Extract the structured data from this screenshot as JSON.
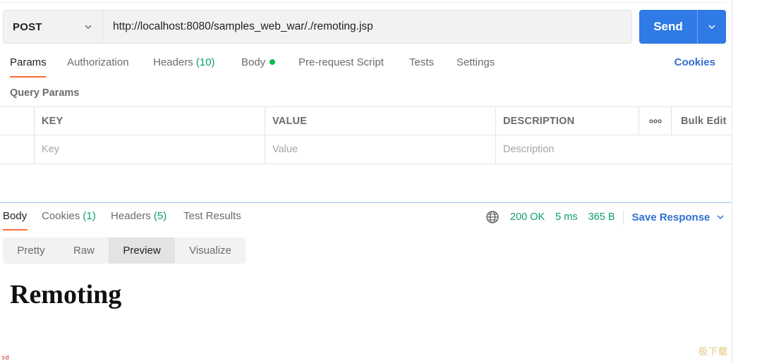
{
  "request": {
    "method": "POST",
    "url": "http://localhost:8080/samples_web_war/./remoting.jsp",
    "send_label": "Send"
  },
  "request_tabs": {
    "params": "Params",
    "authorization": "Authorization",
    "headers": "Headers",
    "headers_count": "(10)",
    "body": "Body",
    "pre_request": "Pre-request Script",
    "tests": "Tests",
    "settings": "Settings",
    "cookies": "Cookies"
  },
  "params_section": {
    "title": "Query Params",
    "columns": {
      "key": "KEY",
      "value": "VALUE",
      "description": "DESCRIPTION",
      "more": "ooo",
      "bulk_edit": "Bulk Edit"
    },
    "placeholders": {
      "key": "Key",
      "value": "Value",
      "description": "Description"
    }
  },
  "response_tabs": {
    "body": "Body",
    "cookies": "Cookies",
    "cookies_count": "(1)",
    "headers": "Headers",
    "headers_count": "(5)",
    "test_results": "Test Results"
  },
  "response_meta": {
    "status": "200 OK",
    "time": "5 ms",
    "size": "365 B",
    "save_response": "Save Response"
  },
  "view_modes": {
    "options": [
      "Pretty",
      "Raw",
      "Preview",
      "Visualize"
    ],
    "selected": "Preview"
  },
  "preview": {
    "title": "Remoting"
  },
  "corner_tag": "sd",
  "watermark": "极下载",
  "colors": {
    "accent_blue": "#2f7ae5",
    "link_blue": "#2f6fd0",
    "tab_underline": "#ff6c37",
    "success_green": "#0d9e63",
    "status_dot": "#0cbb52"
  },
  "icons": {
    "method_dropdown": "chevron-down-icon",
    "send_menu": "chevron-down-icon",
    "network": "globe-icon",
    "save_menu": "chevron-down-icon"
  }
}
